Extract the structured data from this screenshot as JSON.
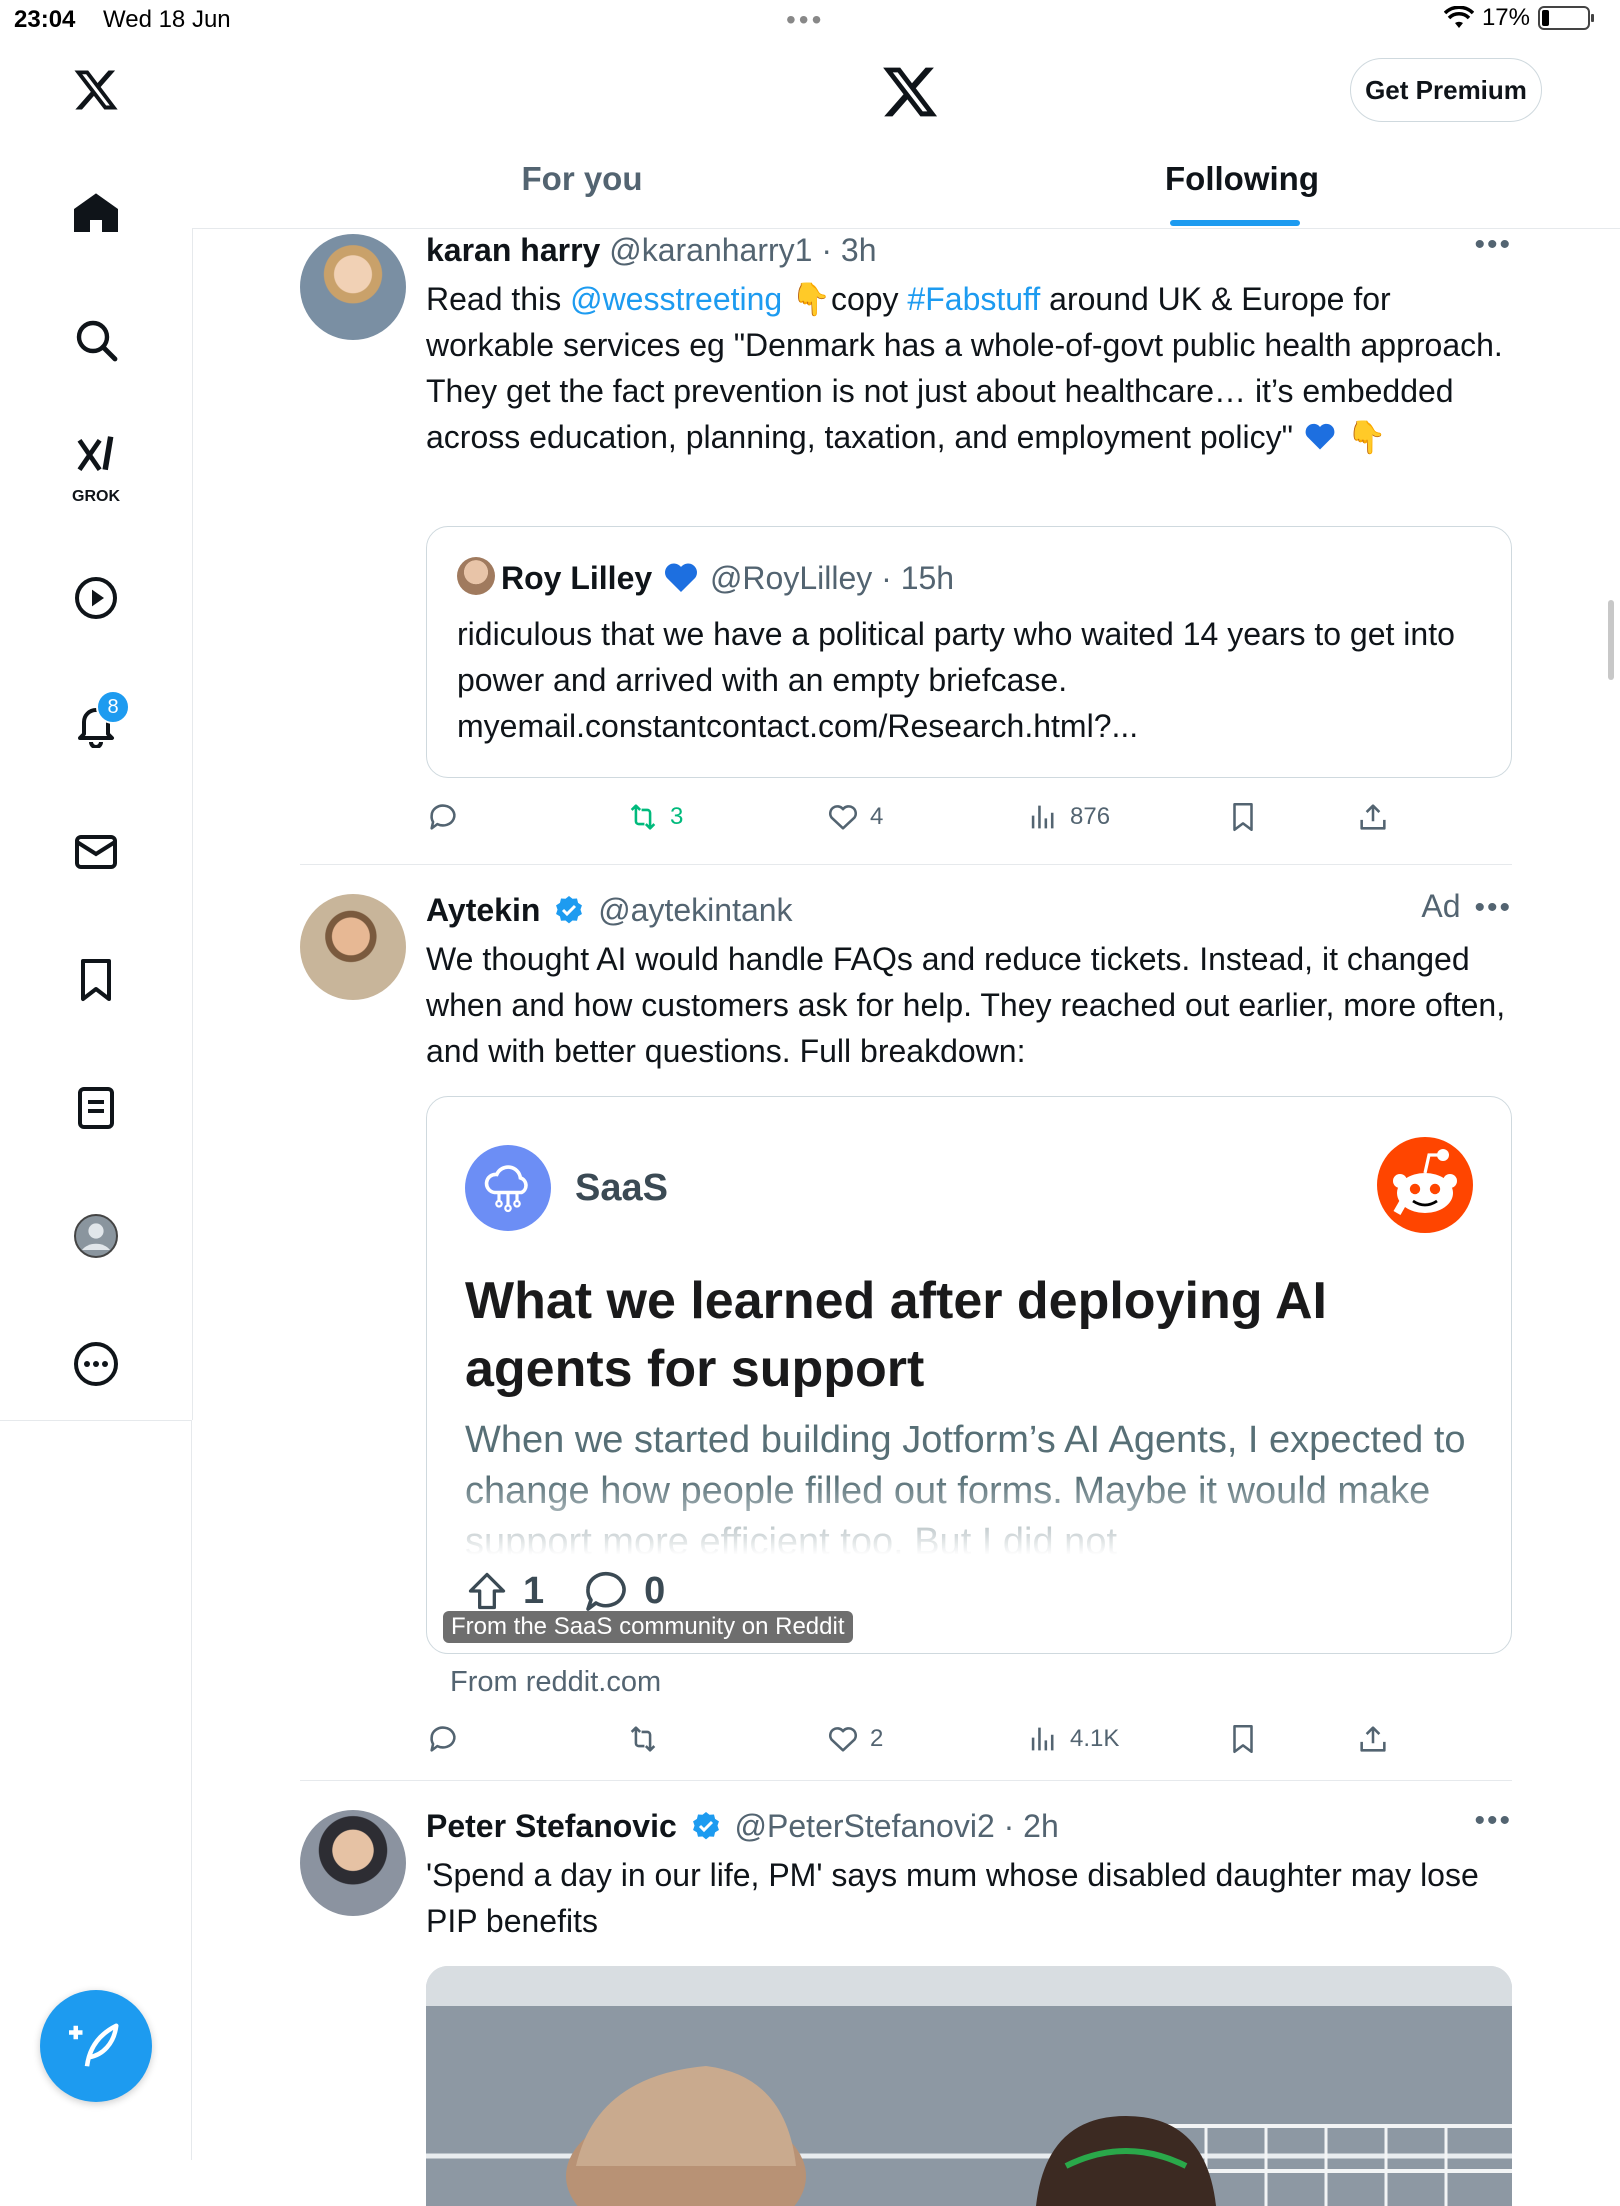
{
  "status_bar": {
    "time": "23:04",
    "date": "Wed 18 Jun",
    "battery": "17%",
    "battery_level": 0.17
  },
  "nav": {
    "grok_label": "GROK",
    "notifications_badge": "8"
  },
  "header": {
    "premium_label": "Get Premium",
    "tabs": [
      "For you",
      "Following"
    ],
    "active_tab": "Following"
  },
  "posts": [
    {
      "name": "karan harry",
      "handle": "@karanharry1",
      "sep": " · ",
      "time": "3h",
      "body_1": "Read this ",
      "mention": "@wesstreeting",
      "body_2": " 👇copy ",
      "hashtag": "#Fabstuff",
      "body_3": " around UK & Europe for workable services eg \"Denmark has a whole-of-govt public health approach. They get the fact prevention is not just about healthcare… it’s embedded across education, planning, taxation, and employment policy\" ",
      "body_4": " 👇",
      "quote": {
        "name": "Roy Lilley",
        "handle": "@RoyLilley",
        "time": "15h",
        "text": "ridiculous that we have a political party who waited 14 years to get into power and arrived with an empty briefcase. myemail.constantcontact.com/Research.html?..."
      },
      "stats": {
        "replies": "",
        "reposts": "3",
        "likes": "4",
        "views": "876"
      }
    },
    {
      "name": "Aytekin",
      "handle": "@aytekintank",
      "ad_label": "Ad",
      "text": "We thought AI would handle FAQs and reduce tickets. Instead, it changed when and how customers ask for help. They reached out earlier, more often, and with better questions. Full breakdown:",
      "card": {
        "community": "SaaS",
        "title": "What we learned after deploying AI agents for support",
        "excerpt": "When we started building Jotform’s AI Agents, I expected to change how people filled out forms. Maybe it would make support more efficient too. But I did not",
        "upvotes": "1",
        "comments": "0",
        "tooltip": "From the SaaS community on Reddit"
      },
      "source": "From reddit.com",
      "stats": {
        "replies": "",
        "reposts": "",
        "likes": "2",
        "views": "4.1K"
      }
    },
    {
      "name": "Peter Stefanovic",
      "handle": "@PeterStefanovi2",
      "sep": " · ",
      "time": "2h",
      "text": "'Spend a day in our life, PM' says mum whose disabled daughter may lose PIP benefits"
    }
  ]
}
